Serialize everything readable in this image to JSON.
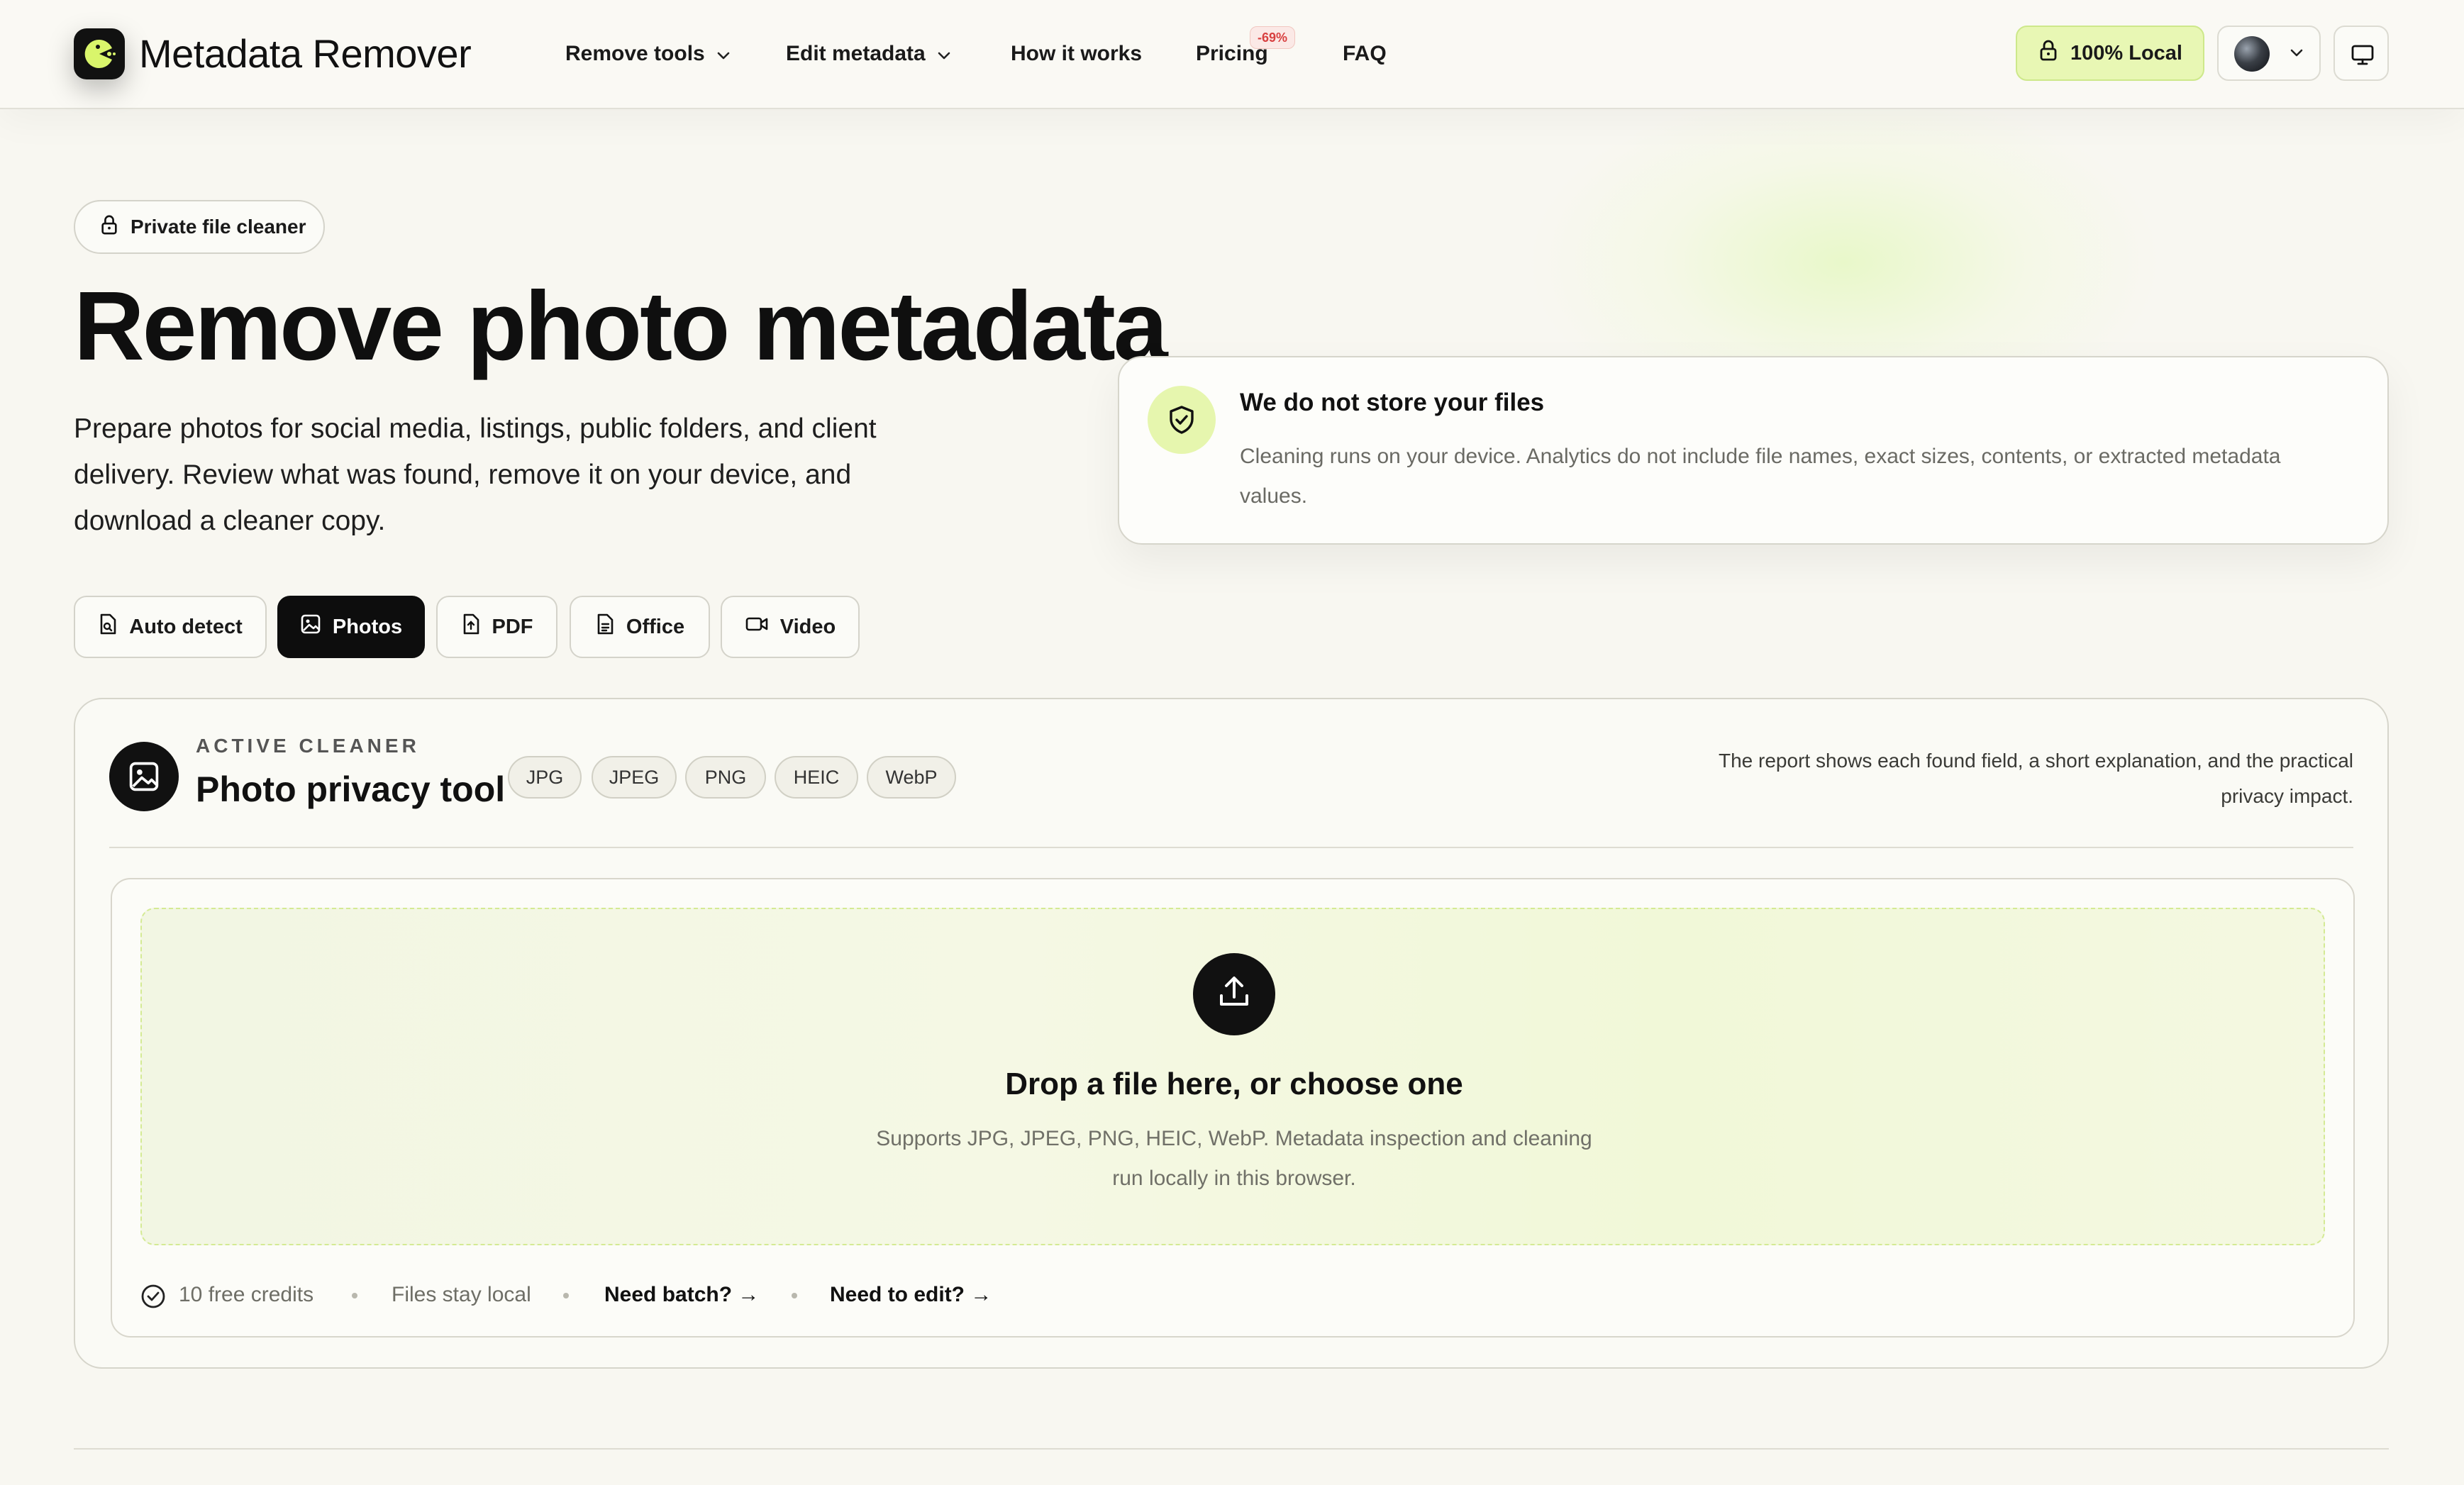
{
  "brand": {
    "name": "Metadata Remover"
  },
  "nav": {
    "remove_tools": "Remove tools",
    "edit_metadata": "Edit metadata",
    "how_it_works": "How it works",
    "pricing": "Pricing",
    "pricing_badge": "-69%",
    "faq": "FAQ"
  },
  "header": {
    "local_label": "100% Local"
  },
  "hero": {
    "pill": "Private file cleaner",
    "title": "Remove photo metadata",
    "lead": "Prepare photos for social media, listings, public folders, and client delivery. Review what was found, remove it on your device, and download a cleaner copy."
  },
  "privacy_card": {
    "title": "We do not store your files",
    "text": "Cleaning runs on your device. Analytics do not include file names, exact sizes, contents, or extracted metadata values."
  },
  "tabs": [
    {
      "label": "Auto detect",
      "icon": "file-search-icon"
    },
    {
      "label": "Photos",
      "icon": "image-icon",
      "active": true
    },
    {
      "label": "PDF",
      "icon": "file-icon"
    },
    {
      "label": "Office",
      "icon": "document-icon"
    },
    {
      "label": "Video",
      "icon": "video-icon"
    }
  ],
  "panel": {
    "eyebrow": "ACTIVE CLEANER",
    "title": "Photo privacy tool",
    "formats": [
      "JPG",
      "JPEG",
      "PNG",
      "HEIC",
      "WebP"
    ],
    "note": "The report shows each found field, a short explanation, and the practical privacy impact."
  },
  "dropzone": {
    "title": "Drop a file here, or choose one",
    "subtitle": "Supports JPG, JPEG, PNG, HEIC, WebP. Metadata inspection and cleaning run locally in this browser."
  },
  "footer_row": {
    "credits": "10 free credits",
    "files_local": "Files stay local",
    "batch": "Need batch? →",
    "edit": "Need to edit? →"
  },
  "colors": {
    "accent": "#e8f7b4",
    "accent_border": "#cde88a",
    "dark": "#0d0d0d",
    "badge_red": "#d84040",
    "background": "#f8f7f1"
  }
}
